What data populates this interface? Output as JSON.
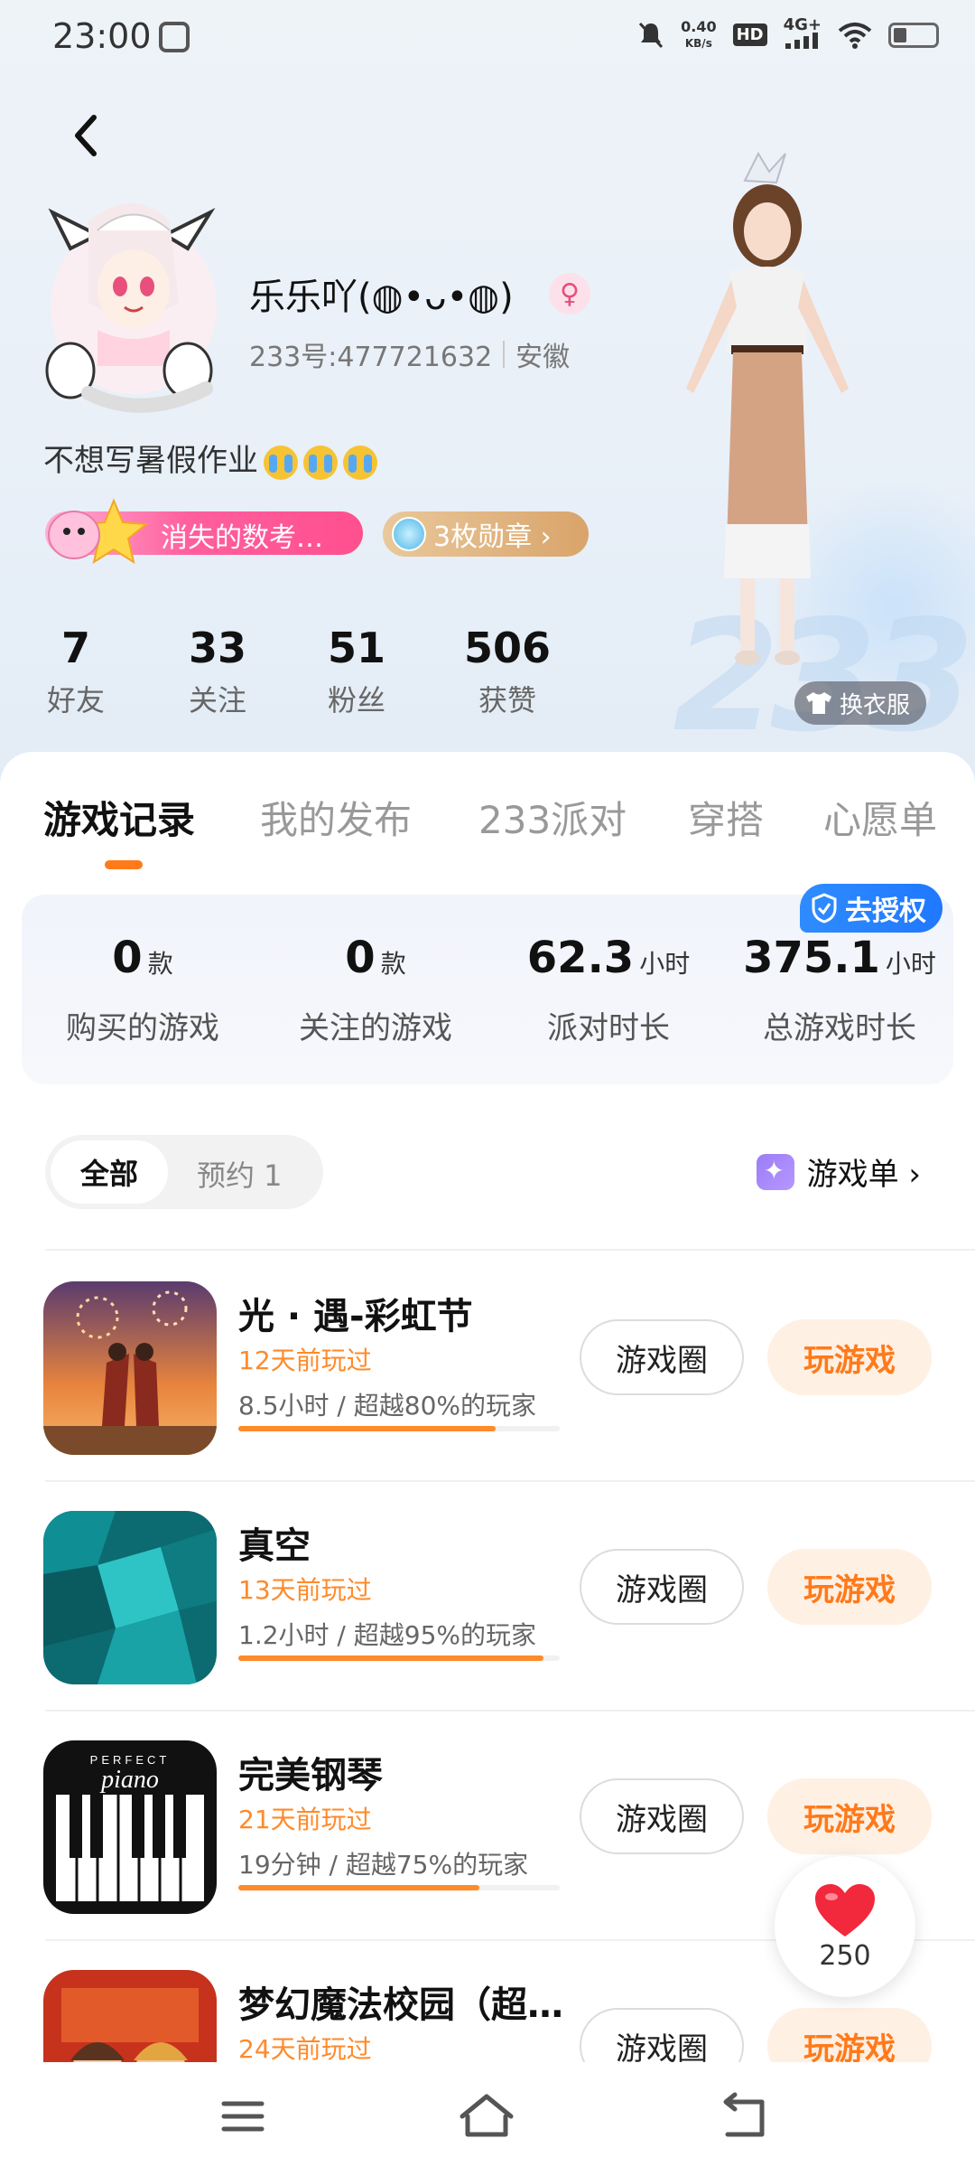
{
  "status_bar": {
    "time": "23:00",
    "net_speed_value": "0.40",
    "net_speed_unit": "KB/s",
    "hd_label": "HD",
    "network_label": "4G+",
    "icons": [
      "mute-icon",
      "hd-icon",
      "signal-icon",
      "wifi-icon",
      "battery-icon"
    ]
  },
  "profile": {
    "nickname": "乐乐吖(◍•ᴗ•◍)",
    "gender_symbol": "♀",
    "user_id": "233号:477721632",
    "location": "安徽",
    "bio": "不想写暑假作业",
    "tag_label": "消失的数考…",
    "medal_label": "3枚勋章 ›",
    "change_outfit_label": "换衣服",
    "stats": [
      {
        "value": "7",
        "label": "好友"
      },
      {
        "value": "33",
        "label": "关注"
      },
      {
        "value": "51",
        "label": "粉丝"
      },
      {
        "value": "506",
        "label": "获赞"
      }
    ]
  },
  "tabs": [
    "游戏记录",
    "我的发布",
    "233派对",
    "穿搭",
    "心愿单"
  ],
  "summary": {
    "auth_label": "去授权",
    "items": [
      {
        "value": "0",
        "unit": "款",
        "label": "购买的游戏"
      },
      {
        "value": "0",
        "unit": "款",
        "label": "关注的游戏"
      },
      {
        "value": "62.3",
        "unit": "小时",
        "label": "派对时长"
      },
      {
        "value": "375.1",
        "unit": "小时",
        "label": "总游戏时长"
      }
    ]
  },
  "filter": {
    "all_label": "全部",
    "reserve_label": "预约 1",
    "game_list_label": "游戏单 ›"
  },
  "games": [
    {
      "name": "光 · 遇-彩虹节",
      "played": "12天前玩过",
      "time": "8.5小时 / 超越80%的玩家",
      "percentile": 0.8,
      "circle_label": "游戏圈",
      "play_label": "玩游戏"
    },
    {
      "name": "真空",
      "played": "13天前玩过",
      "time": "1.2小时 / 超越95%的玩家",
      "percentile": 0.95,
      "circle_label": "游戏圈",
      "play_label": "玩游戏"
    },
    {
      "name": "完美钢琴",
      "played": "21天前玩过",
      "time": "19分钟 / 超越75%的玩家",
      "percentile": 0.75,
      "circle_label": "游戏圈",
      "play_label": "玩游戏"
    },
    {
      "name": "梦幻魔法校园（超…",
      "played": "24天前玩过",
      "time": "",
      "percentile": 0,
      "circle_label": "游戏圈",
      "play_label": "玩游戏"
    }
  ],
  "piano_logo_top": "PERFECT",
  "piano_logo_main": "piano",
  "like": {
    "count": "250"
  },
  "colors": {
    "accent": "#ff7a1a",
    "auth_blue": "#1f78ff",
    "tag_pink": "#ff4f8e"
  }
}
